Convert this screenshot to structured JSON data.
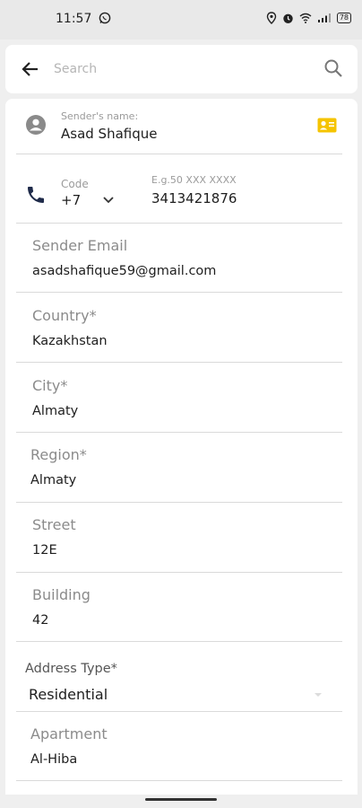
{
  "status_bar": {
    "time": "11:57",
    "battery": "78"
  },
  "search": {
    "placeholder": "Search"
  },
  "sender": {
    "name_label": "Sender's name:",
    "name_value": "Asad Shafique"
  },
  "phone": {
    "code_label": "Code",
    "code_value": "+7",
    "number_hint": "E.g.50 XXX XXXX",
    "number_value": "3413421876"
  },
  "fields": {
    "email": {
      "label": "Sender Email",
      "value": "asadshafique59@gmail.com"
    },
    "country": {
      "label": "Country*",
      "value": "Kazakhstan"
    },
    "city": {
      "label": "City*",
      "value": "Almaty"
    },
    "region": {
      "label": "Region*",
      "value": "Almaty"
    },
    "street": {
      "label": "Street",
      "value": "12E"
    },
    "building": {
      "label": "Building",
      "value": "42"
    },
    "address_type": {
      "label": "Address Type*",
      "value": "Residential"
    },
    "apartment": {
      "label": "Apartment",
      "value": "Al-Hiba"
    }
  },
  "colors": {
    "accent_yellow": "#f5c400",
    "phone_icon": "#1f2b4a",
    "card_bg": "#ffffff",
    "page_bg": "#efefef"
  }
}
